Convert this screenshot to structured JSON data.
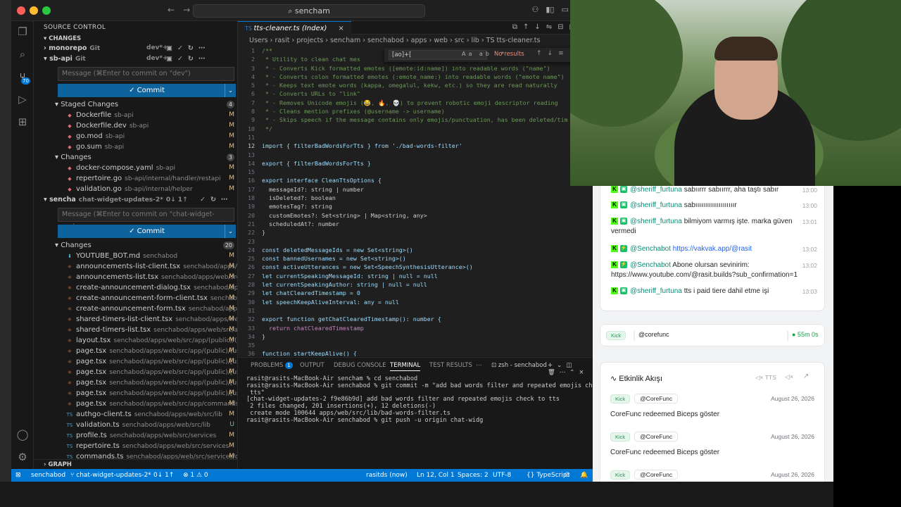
{
  "window": {
    "search": "sencham",
    "nav_back": "←",
    "nav_fwd": "→"
  },
  "sidebar": {
    "title": "SOURCE CONTROL",
    "changes_header": "CHANGES",
    "repos": [
      {
        "name": "monorepo",
        "type": "Git",
        "branch": "dev*+"
      },
      {
        "name": "sb-api",
        "type": "Git",
        "branch": "dev*+"
      }
    ],
    "sbapi_message_placeholder": "Message (⌘Enter to commit on \"dev\")",
    "commit_label": "✓ Commit",
    "staged_header": "Staged Changes",
    "staged_count": "4",
    "staged": [
      {
        "file": "Dockerfile",
        "path": "sb-api",
        "status": "M"
      },
      {
        "file": "Dockerfile.dev",
        "path": "sb-api",
        "status": "M"
      },
      {
        "file": "go.mod",
        "path": "sb-api",
        "status": "M"
      },
      {
        "file": "go.sum",
        "path": "sb-api",
        "status": "M"
      }
    ],
    "changes_label": "Changes",
    "changes_count": "3",
    "changes": [
      {
        "file": "docker-compose.yaml",
        "path": "sb-api",
        "status": "M"
      },
      {
        "file": "repertoire.go",
        "path": "sb-api/internal/handler/restapi",
        "status": "M"
      },
      {
        "file": "validation.go",
        "path": "sb-api/internal/helper",
        "status": "M"
      }
    ],
    "sencha_repo": {
      "name": "sencha",
      "branch": "chat-widget-updates-2*",
      "sync": "0↓ 1↑"
    },
    "sencha_message_placeholder": "Message (⌘Enter to commit on \"chat-widget-upda...",
    "sencha_changes_count": "20",
    "sencha_changes": [
      {
        "file": "YOUTUBE_BOT.md",
        "path": "senchabod",
        "status": "M",
        "icon": "d"
      },
      {
        "file": "announcements-list-client.tsx",
        "path": "senchabod/apps/web/sr...",
        "status": "M",
        "icon": "r"
      },
      {
        "file": "announcements-list.tsx",
        "path": "senchabod/apps/web/src/app/(...",
        "status": "M",
        "icon": "r"
      },
      {
        "file": "create-announcement-dialog.tsx",
        "path": "senchabod/apps/web...",
        "status": "M",
        "icon": "r"
      },
      {
        "file": "create-announcement-form-client.tsx",
        "path": "senchabod/app...",
        "status": "M",
        "icon": "r"
      },
      {
        "file": "create-announcement-form.tsx",
        "path": "senchabod/apps/web/...",
        "status": "M",
        "icon": "r"
      },
      {
        "file": "shared-timers-list-client.tsx",
        "path": "senchabod/apps/web/sr...",
        "status": "M",
        "icon": "r"
      },
      {
        "file": "shared-timers-list.tsx",
        "path": "senchabod/apps/web/src/app/(pr...",
        "status": "M",
        "icon": "r"
      },
      {
        "file": "layout.tsx",
        "path": "senchabod/apps/web/src/app/(public)/(userna...",
        "status": "M",
        "icon": "r"
      },
      {
        "file": "page.tsx",
        "path": "senchabod/apps/web/src/app/(public)/(userna...",
        "status": "M",
        "icon": "r"
      },
      {
        "file": "page.tsx",
        "path": "senchabod/apps/web/src/app/(public)/[userna...",
        "status": "M",
        "icon": "r"
      },
      {
        "file": "page.tsx",
        "path": "senchabod/apps/web/src/app/(public)/[userna...",
        "status": "M",
        "icon": "r"
      },
      {
        "file": "page.tsx",
        "path": "senchabod/apps/web/src/app/(public)/[userna...",
        "status": "M",
        "icon": "r"
      },
      {
        "file": "page.tsx",
        "path": "senchabod/apps/web/src/app/(public)/[userna...",
        "status": "M",
        "icon": "r"
      },
      {
        "file": "page.tsx",
        "path": "senchabod/apps/web/src/app/commands/[chan...",
        "status": "M",
        "icon": "r"
      },
      {
        "file": "authgo-client.ts",
        "path": "senchabod/apps/web/src/lib",
        "status": "M",
        "icon": "t"
      },
      {
        "file": "validation.ts",
        "path": "senchabod/apps/web/src/lib",
        "status": "U",
        "icon": "t"
      },
      {
        "file": "profile.ts",
        "path": "senchabod/apps/web/src/services",
        "status": "M",
        "icon": "t"
      },
      {
        "file": "repertoire.ts",
        "path": "senchabod/apps/web/src/services",
        "status": "M",
        "icon": "t"
      },
      {
        "file": "commands.ts",
        "path": "senchabod/apps/web/src/services/queries",
        "status": "M",
        "icon": "t"
      }
    ],
    "graph_label": "GRAPH"
  },
  "editor": {
    "tab_title": "tts-cleaner.ts (Index)",
    "breadcrumb": "Users  ›  rasit  ›  projects  ›  sencham  ›  senchabod  ›  apps  ›  web  ›  src  ›  lib  ›  TS tts-cleaner.ts",
    "find_query": "[ao]+[",
    "find_result": "No results",
    "lines": [
      "/**",
      " * Utility to clean chat mes",
      " * - Converts Kick formatted emotes ([emote:id:name]) into readable words (\"name\")",
      " * - Converts colon formatted emotes (:emote_name:) into readable words (\"emote name\")",
      " * - Keeps text emote words (kappa, omegalul, kekw, etc.) so they are read naturally",
      " * - Converts URLs to \"link\"",
      " * - Removes Unicode emojis (😂, 🔥, 💀) to prevent robotic emoji descriptor reading",
      " * - Cleans mention prefixes (@username -> username)",
      " * - Skips speech if the message contains only emojis/punctuation, has been deleted/tim",
      " */",
      "",
      "import { filterBadWordsForTts } from './bad-words-filter'",
      "",
      "export { filterBadWordsForTts }",
      "",
      "export interface CleanTtsOptions {",
      "  messageId?: string | number",
      "  isDeleted?: boolean",
      "  emotesTag?: string",
      "  customEmotes?: Set<string> | Map<string, any>",
      "  scheduledAt?: number",
      "}",
      "",
      "const deletedMessageIds = new Set<string>()",
      "const bannedUsernames = new Set<string>()",
      "const activeUtterances = new Set<SpeechSynthesisUtterance>()",
      "let currentSpeakingMessageId: string | null = null",
      "let currentSpeakingAuthor: string | null = null",
      "let chatClearedTimestamp = 0",
      "let speechKeepAliveInterval: any = null",
      "",
      "export function getChatClearedTimestamp(): number {",
      "  return chatClearedTimestamp",
      "}",
      "",
      "function startKeepAlive() {"
    ]
  },
  "panel": {
    "tabs": [
      "PROBLEMS",
      "OUTPUT",
      "DEBUG CONSOLE",
      "TERMINAL",
      "TEST RESULTS"
    ],
    "problems_count": "1",
    "terminal_name": "zsh - senchabod",
    "terminal": "rasit@rasits-MacBook-Air sencham % cd senchabod\nrasit@rasits-MacBook-Air senchabod % git commit -m \"add bad words filter and repeated emojis check to\n tts\"\n[chat-widget-updates-2 f9e86b9d] add bad words filter and repeated emojis check to tts\n 2 files changed, 201 insertions(+), 12 deletions(-)\n create mode 100644 apps/web/src/lib/bad-words-filter.ts\nrasit@rasits-MacBook-Air senchabod % git push -u origin chat-widg"
  },
  "statusbar": {
    "repo": "senchabod",
    "branch": "chat-widget-updates-2*",
    "sync": "0↓ 1↑",
    "problems": "⊗ 1  ⚠ 0",
    "user": "rasitds (now)",
    "position": "Ln 12, Col 1",
    "spaces": "Spaces: 2",
    "encoding": "UTF-8",
    "language": "TypeScript"
  },
  "chat": {
    "messages": [
      {
        "user": "@sheriff_furtuna",
        "text": "sabıırrr sabıırrr, aha taştı sabır",
        "time": "13:00"
      },
      {
        "user": "@sheriff_furtuna",
        "text": "sabıııııııııııııııııııır",
        "time": "13:00"
      },
      {
        "user": "@sheriff_furtuna",
        "text": "bilmiyom varmış işte. marka güven vermedi",
        "time": "13:01"
      },
      {
        "user": "@Senchabot",
        "text": "https://vakvak.app/@rasit",
        "time": "13:02"
      },
      {
        "user": "@Senchabot",
        "text": "Abone olursan sevinirim: https://www.youtube.com/@rasit.builds?sub_confirmation=1",
        "time": "13:02"
      },
      {
        "user": "@sheriff_furtuna",
        "text": "tts i paid tiere dahil etme işi",
        "time": "13:03"
      }
    ],
    "platform": "Kick",
    "channel": "@corefunc",
    "live_time": "● 55m 0s"
  },
  "activity": {
    "title": "Etkinlik Akışı",
    "tts_toggle": "TTS",
    "events": [
      {
        "platform": "Kick",
        "user": "@CoreFunc",
        "date": "August 26, 2026",
        "text": "CoreFunc redeemed Biceps göster"
      },
      {
        "platform": "Kick",
        "user": "@CoreFunc",
        "date": "August 26, 2026",
        "text": "CoreFunc redeemed Biceps göster"
      },
      {
        "platform": "Kick",
        "user": "@CoreFunc",
        "date": "August 26, 2026",
        "text": ""
      }
    ]
  },
  "colors": {
    "accent": "#0078d4",
    "kick": "#53fc18",
    "mention": "#0d8a74"
  }
}
